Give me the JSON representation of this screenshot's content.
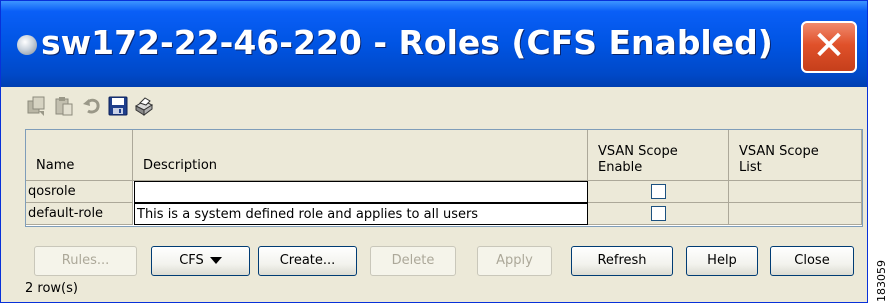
{
  "window": {
    "title": "sw172-22-46-220 - Roles (CFS Enabled)",
    "close_glyph": "✕",
    "title_icon": "app-status-dot-icon",
    "accent_color": "#0054e3",
    "close_color": "#e0512a"
  },
  "toolbar": {
    "icons": [
      "copy-icon",
      "paste-icon",
      "undo-icon",
      "save-icon",
      "print-icon"
    ]
  },
  "table": {
    "columns": [
      "Name",
      "Description",
      "VSAN Scope Enable",
      "VSAN Scope List"
    ],
    "column_lines": {
      "vsan_enable": [
        "VSAN Scope",
        "Enable"
      ],
      "vsan_list": [
        "VSAN Scope",
        "List"
      ]
    },
    "rows": [
      {
        "name": "qosrole",
        "description": "",
        "vsan_scope_enable": false,
        "vsan_scope_list": ""
      },
      {
        "name": "default-role",
        "description": "This is a system defined role and applies to all users",
        "vsan_scope_enable": false,
        "vsan_scope_list": ""
      }
    ]
  },
  "buttons": {
    "rules": "Rules...",
    "cfs": "CFS",
    "create": "Create...",
    "delete": "Delete",
    "apply": "Apply",
    "refresh": "Refresh",
    "help": "Help",
    "close": "Close"
  },
  "status": {
    "row_count": "2 row(s)"
  },
  "figure_id": "183059"
}
